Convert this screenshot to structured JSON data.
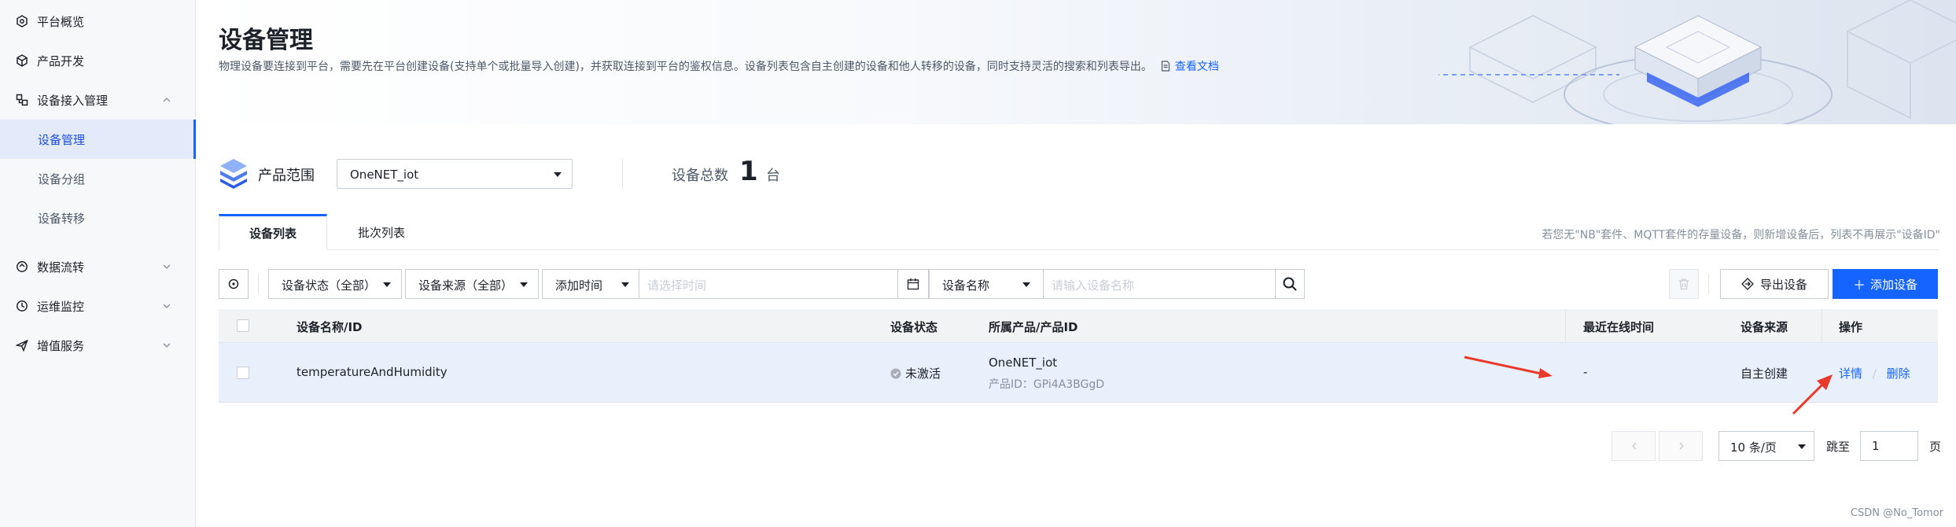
{
  "sidebar": {
    "items": [
      {
        "label": "平台概览",
        "icon": "platform-overview-icon"
      },
      {
        "label": "产品开发",
        "icon": "cube-icon"
      },
      {
        "label": "设备接入管理",
        "icon": "device-access-icon"
      },
      {
        "label": "设备管理"
      },
      {
        "label": "设备分组"
      },
      {
        "label": "设备转移"
      },
      {
        "label": "数据流转",
        "icon": "data-flow-icon"
      },
      {
        "label": "运维监控",
        "icon": "monitor-icon"
      },
      {
        "label": "增值服务",
        "icon": "send-icon"
      }
    ]
  },
  "header": {
    "title": "设备管理",
    "description": "物理设备要连接到平台，需要先在平台创建设备(支持单个或批量导入创建)，并获取连接到平台的鉴权信息。设备列表包含自主创建的设备和他人转移的设备，同时支持灵活的搜索和列表导出。",
    "doc_link": "查看文档"
  },
  "product_scope": {
    "label": "产品范围",
    "selected": "OneNET_iot",
    "total_label": "设备总数",
    "total_value": "1",
    "total_unit": "台"
  },
  "tabs": [
    {
      "label": "设备列表"
    },
    {
      "label": "批次列表"
    }
  ],
  "tab_note": "若您无\"NB\"套件、MQTT套件的存量设备，则新增设备后，列表不再展示\"设备ID\"",
  "filters": {
    "status": "设备状态（全部）",
    "source": "设备来源（全部）",
    "time_field": "添加时间",
    "time_placeholder": "请选择时间",
    "name_field": "设备名称",
    "name_placeholder": "请输入设备名称",
    "export": "导出设备",
    "add": "添加设备",
    "add_plus": "＋"
  },
  "table": {
    "headers": {
      "name": "设备名称/ID",
      "status": "设备状态",
      "product": "所属产品/产品ID",
      "last_online": "最近在线时间",
      "source": "设备来源",
      "action": "操作"
    },
    "rows": [
      {
        "name": "temperatureAndHumidity",
        "status": "未激活",
        "product": "OneNET_iot",
        "product_id": "产品ID：GPi4A3BGgD",
        "last_online": "-",
        "source": "自主创建",
        "detail": "详情",
        "sep": "/",
        "delete": "删除"
      }
    ]
  },
  "pagination": {
    "page_size": "10 条/页",
    "jump_label": "跳至",
    "jump_value": "1",
    "page_unit": "页"
  },
  "watermark": "CSDN @No_Tomor",
  "colors": {
    "primary": "#1664ff",
    "active_bg": "#e3ebfa",
    "row_highlight": "#e8f0fc",
    "arrow": "#e8392b"
  }
}
